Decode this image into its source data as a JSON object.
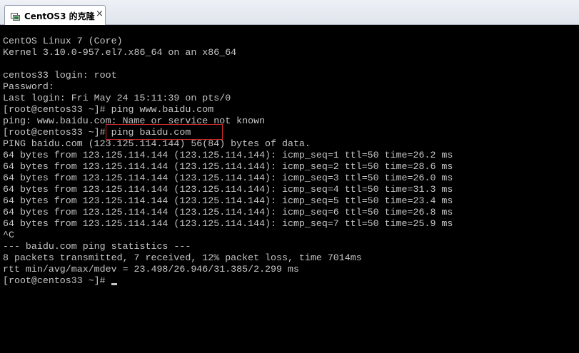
{
  "tab": {
    "title": "CentOS3 的克隆",
    "close_glyph": "×",
    "icon": "vm-icon"
  },
  "console": {
    "foreground": "#c6c6c6",
    "background": "#000000",
    "highlight_color": "#d42a2a",
    "lines": [
      "CentOS Linux 7 (Core)",
      "Kernel 3.10.0-957.el7.x86_64 on an x86_64",
      "",
      "centos33 login: root",
      "Password:",
      "Last login: Fri May 24 15:11:39 on pts/0",
      "[root@centos33 ~]# ping www.baidu.com",
      "ping: www.baidu.com: Name or service not known",
      "[root@centos33 ~]# ping baidu.com",
      "PING baidu.com (123.125.114.144) 56(84) bytes of data.",
      "64 bytes from 123.125.114.144 (123.125.114.144): icmp_seq=1 ttl=50 time=26.2 ms",
      "64 bytes from 123.125.114.144 (123.125.114.144): icmp_seq=2 ttl=50 time=28.6 ms",
      "64 bytes from 123.125.114.144 (123.125.114.144): icmp_seq=3 ttl=50 time=26.0 ms",
      "64 bytes from 123.125.114.144 (123.125.114.144): icmp_seq=4 ttl=50 time=31.3 ms",
      "64 bytes from 123.125.114.144 (123.125.114.144): icmp_seq=5 ttl=50 time=23.4 ms",
      "64 bytes from 123.125.114.144 (123.125.114.144): icmp_seq=6 ttl=50 time=26.8 ms",
      "64 bytes from 123.125.114.144 (123.125.114.144): icmp_seq=7 ttl=50 time=25.9 ms",
      "^C",
      "--- baidu.com ping statistics ---",
      "8 packets transmitted, 7 received, 12% packet loss, time 7014ms",
      "rtt min/avg/max/mdev = 23.498/26.946/31.385/2.299 ms",
      "[root@centos33 ~]#"
    ]
  }
}
